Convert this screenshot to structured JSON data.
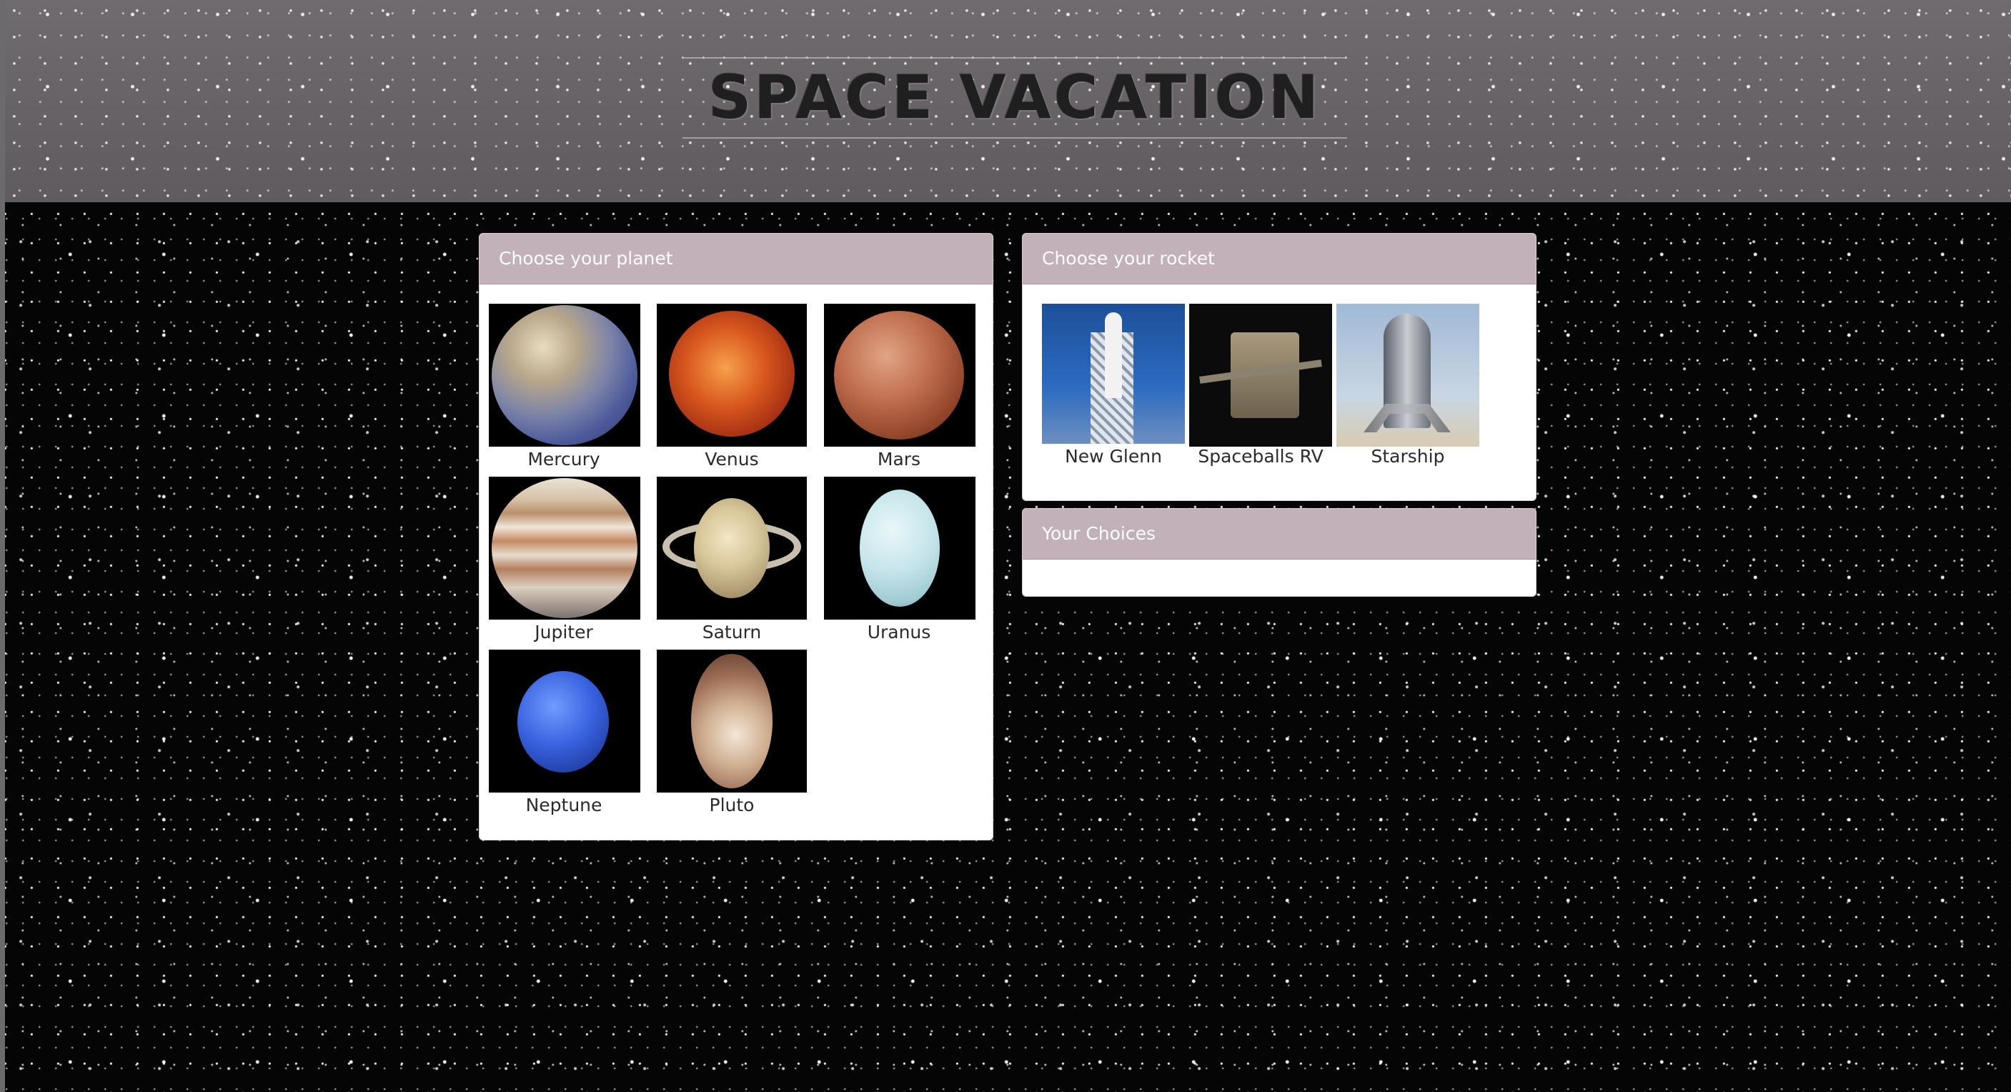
{
  "site": {
    "title": "SPACE VACATION"
  },
  "planets_panel": {
    "heading": "Choose your planet",
    "planets": [
      {
        "name": "Mercury",
        "icon": "mercury-image"
      },
      {
        "name": "Venus",
        "icon": "venus-image"
      },
      {
        "name": "Mars",
        "icon": "mars-image"
      },
      {
        "name": "Jupiter",
        "icon": "jupiter-image"
      },
      {
        "name": "Saturn",
        "icon": "saturn-image"
      },
      {
        "name": "Uranus",
        "icon": "uranus-image"
      },
      {
        "name": "Neptune",
        "icon": "neptune-image"
      },
      {
        "name": "Pluto",
        "icon": "pluto-image"
      }
    ]
  },
  "rockets_panel": {
    "heading": "Choose your rocket",
    "rockets": [
      {
        "name": "New Glenn",
        "icon": "new-glenn-image"
      },
      {
        "name": "Spaceballs RV",
        "icon": "spaceballs-rv-image"
      },
      {
        "name": "Starship",
        "icon": "starship-image"
      }
    ]
  },
  "choices_panel": {
    "heading": "Your Choices"
  },
  "colors": {
    "panel_header": "#c3b1ba",
    "banner": "#6b676b",
    "background": "#050505"
  }
}
